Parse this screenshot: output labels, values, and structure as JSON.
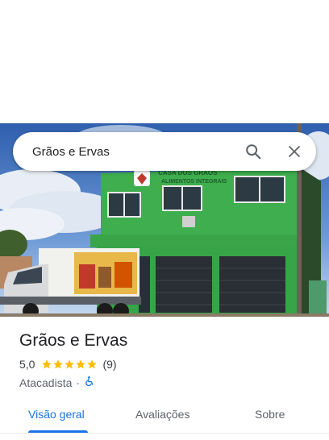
{
  "search": {
    "query": "Grãos e Ervas",
    "search_icon": "search-icon",
    "close_icon": "close-icon"
  },
  "photo": {
    "building_sign": "ALIMENTOS INTEGRAIS"
  },
  "place": {
    "name": "Grãos e Ervas",
    "rating": "5,0",
    "stars": 5,
    "review_count": "(9)",
    "category": "Atacadista",
    "separator": "·",
    "accessibility_icon": "wheelchair-icon"
  },
  "tabs": [
    {
      "label": "Visão geral",
      "active": true
    },
    {
      "label": "Avaliações",
      "active": false
    },
    {
      "label": "Sobre",
      "active": false
    }
  ],
  "colors": {
    "accent": "#1a73e8",
    "star": "#fbbc04",
    "building": "#3aa84a"
  }
}
